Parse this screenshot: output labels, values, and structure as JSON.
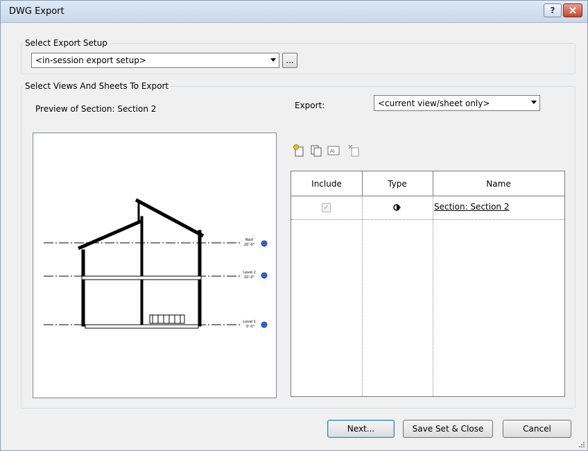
{
  "window": {
    "title": "DWG Export",
    "help_label": "?",
    "close_label": "x"
  },
  "export_setup": {
    "legend": "Select Export Setup",
    "selected": "<in-session export setup>",
    "more_label": "..."
  },
  "views": {
    "legend": "Select Views And Sheets To Export",
    "preview_title": "Preview of Section: Section 2",
    "export_label": "Export:",
    "export_selected": "<current view/sheet only>",
    "toolbar_icons": [
      "new-set-icon",
      "duplicate-set-icon",
      "rename-set-icon",
      "delete-set-icon"
    ],
    "table": {
      "columns": [
        "Include",
        "Type",
        "Name"
      ],
      "rows": [
        {
          "include": true,
          "type_icon": "section-view-icon",
          "name": "Section: Section 2"
        }
      ]
    }
  },
  "preview_drawing": {
    "levels": [
      {
        "name": "Roof",
        "elevation": "20'-0\""
      },
      {
        "name": "Level 2",
        "elevation": "10'-0\""
      },
      {
        "name": "Level 1",
        "elevation": "0'-0\""
      }
    ]
  },
  "buttons": {
    "next": "Next...",
    "save_close": "Save Set & Close",
    "cancel": "Cancel"
  }
}
